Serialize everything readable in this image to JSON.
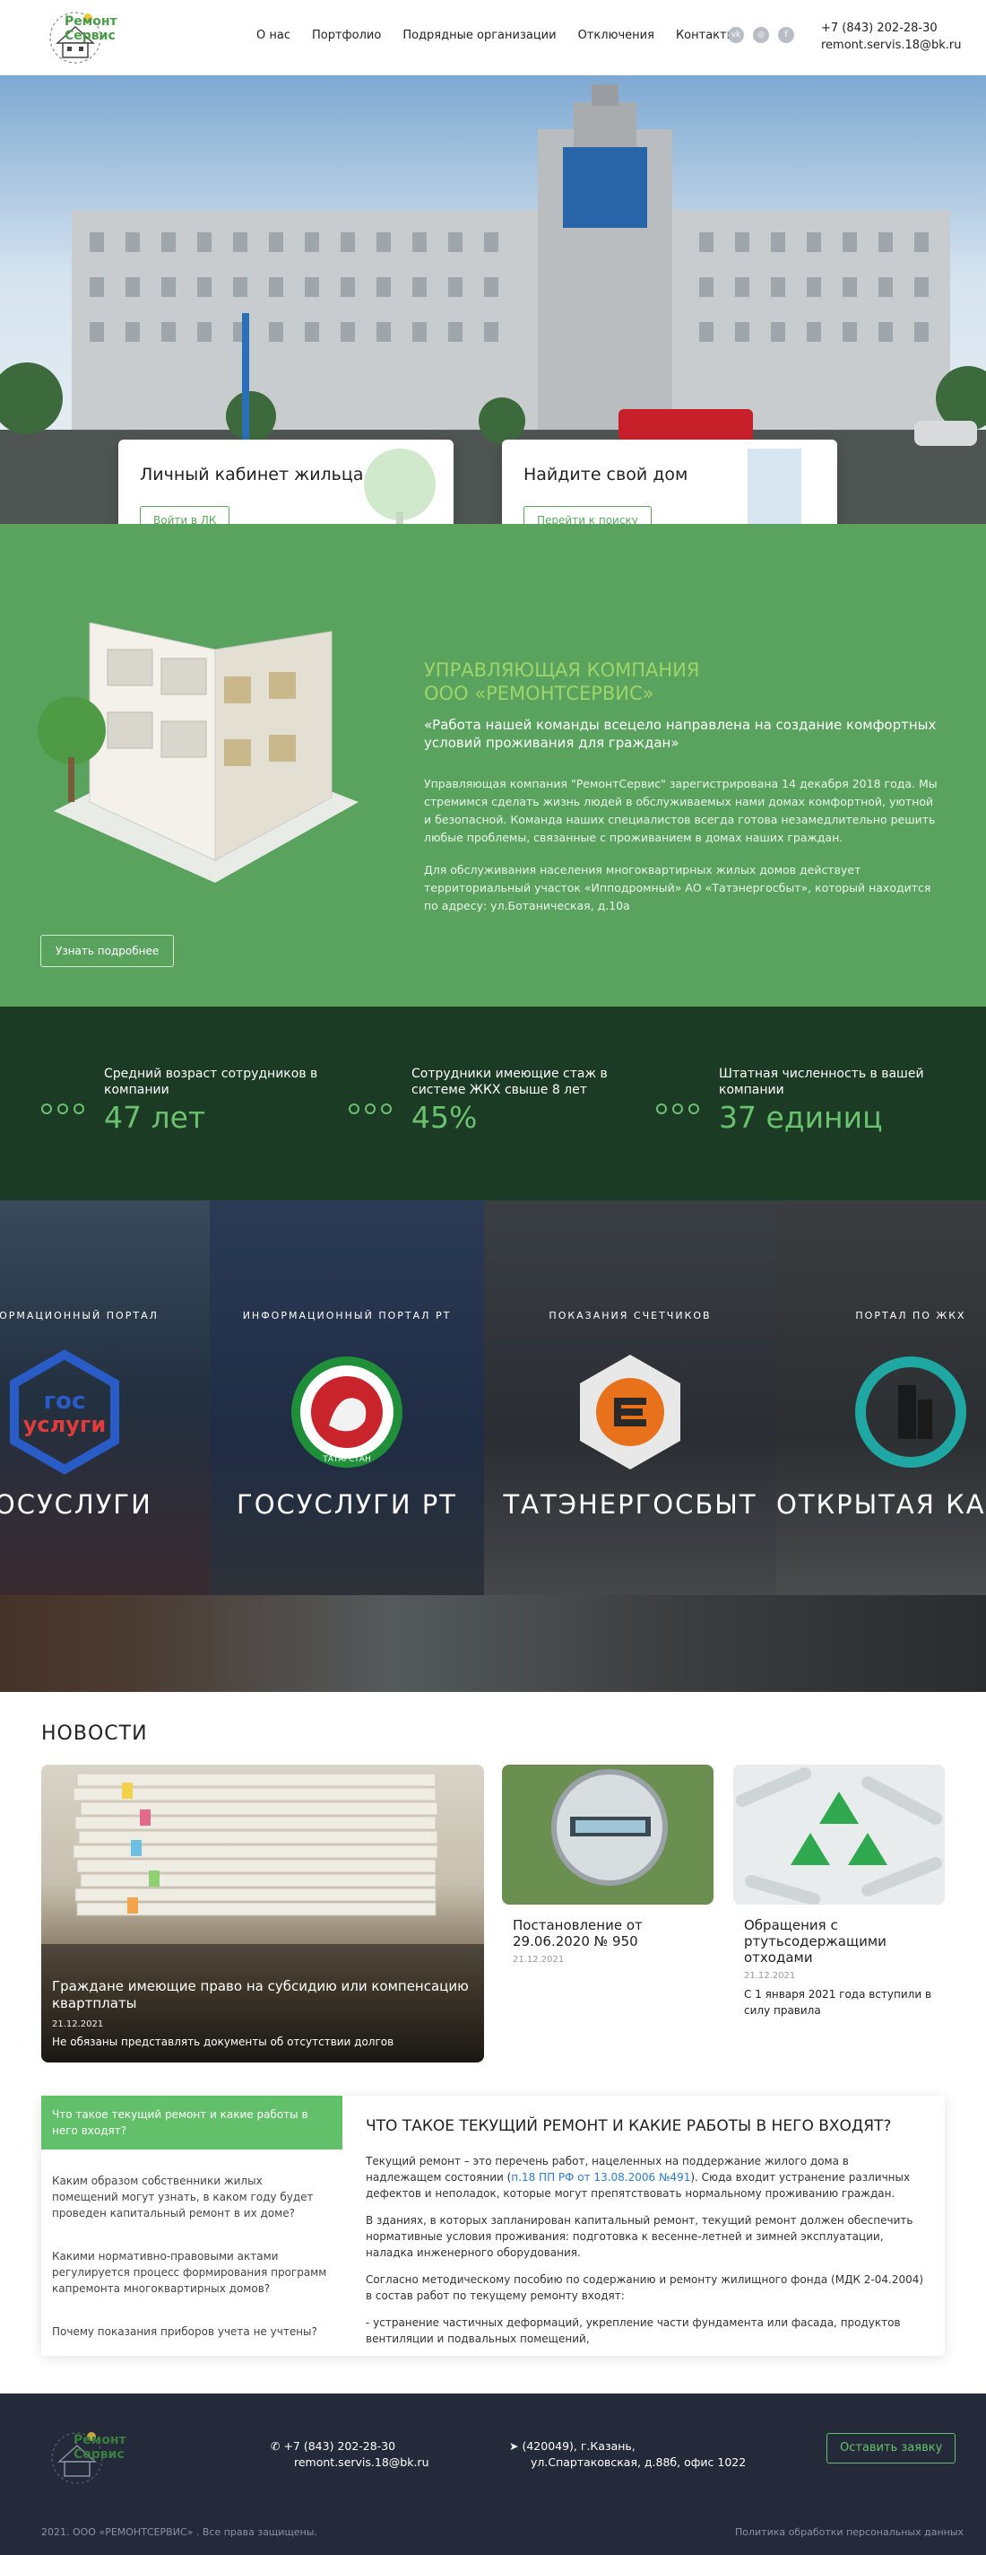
{
  "header": {
    "logo_text_1": "Ремонт",
    "logo_text_2": "Сервис",
    "nav": [
      "О нас",
      "Портфолио",
      "Подрядные организации",
      "Отключения",
      "Контакты"
    ],
    "socials": [
      "vk-icon",
      "instagram-icon",
      "facebook-icon"
    ],
    "phone": "+7 (843) 202-28-30",
    "email": "remont.servis.18@bk.ru"
  },
  "hero": {
    "card1": {
      "title": "Личный кабинет жильца",
      "button": "Войти в ЛК"
    },
    "card2": {
      "title": "Найдите свой дом",
      "button": "Перейти к поиску"
    }
  },
  "about": {
    "title_1": "УПРАВЛЯЮЩАЯ КОМПАНИЯ",
    "title_2": "ООО «РЕМОНТСЕРВИС»",
    "quote": "«Работа нашей команды всецело направлена на создание комфортных условий проживания для граждан»",
    "paragraph_1": "Управляющая компания \"РемонтСервис\" зарегистрирована 14 декабря 2018 года. Мы стремимся сделать жизнь людей в обслуживаемых нами домах комфортной, уютной и безопасной. Команда наших специалистов всегда готова незамедлительно решить любые проблемы, связанные с проживанием в домах наших граждан.",
    "paragraph_2": "Для обслуживания населения многоквартирных жилых домов действует территориальный участок «Ипподромный» АО «Татэнергосбыт», который находится по адресу: ул.Ботаническая, д.10а",
    "button": "Узнать подробнее"
  },
  "stats": [
    {
      "label": "Средний возраст сотрудников в компании",
      "value": "47 лет"
    },
    {
      "label": "Сотрудники имеющие стаж в системе ЖКХ свыше 8 лет",
      "value": "45%"
    },
    {
      "label": "Штатная численность в вашей компании",
      "value": "37 единиц"
    }
  ],
  "portals": [
    {
      "caption": "ИНФОРМАЦИОННЫЙ ПОРТАЛ",
      "name": "ГОСУСЛУГИ",
      "emblem_text_1": "гос",
      "emblem_text_2": "услуги"
    },
    {
      "caption": "ИНФОРМАЦИОННЫЙ ПОРТАЛ РТ",
      "name": "ГОСУСЛУГИ РТ",
      "emblem_text_1": "ТАТАРСТАН"
    },
    {
      "caption": "ПОКАЗАНИЯ СЧЕТЧИКОВ",
      "name": "ТАТЭНЕРГОСБЫТ"
    },
    {
      "caption": "ПОРТАЛ ПО ЖКХ",
      "name": "ОТКРЫТАЯ КАЗАНЬ"
    }
  ],
  "news": {
    "title": "НОВОСТИ",
    "big": {
      "title": "Граждане имеющие право на субсидию или компенсацию квартплаты",
      "date": "21.12.2021",
      "summary": "Не обязаны представлять документы об отсутствии долгов"
    },
    "cards": [
      {
        "title": "Постановление от 29.06.2020 № 950",
        "date": "21.12.2021",
        "summary": ""
      },
      {
        "title": "Обращения с ртутьсодержащими отходами",
        "date": "21.12.2021",
        "summary": "С 1 января 2021 года вступили в силу правила"
      }
    ]
  },
  "faq": {
    "items": [
      "Что такое текущий ремонт и какие работы в него входят?",
      "Каким образом собственники жилых помещений могут узнать, в каком году будет проведен капитальный ремонт в их доме?",
      "Какими нормативно-правовыми актами регулируется процесс формирования программ капремонта многоквартирных домов?",
      "Почему показания приборов учета не учтены?"
    ],
    "heading": "ЧТО ТАКОЕ ТЕКУЩИЙ РЕМОНТ И КАКИЕ РАБОТЫ В НЕГО ВХОДЯТ?",
    "p1_before": "Текущий ремонт – это перечень работ, нацеленных на поддержание жилого дома в надлежащем состоянии (",
    "p1_link": "п.18 ПП РФ от 13.08.2006 №491",
    "p1_after": "). Сюда входит устранение различных дефектов и неполадок, которые могут препятствовать нормальному проживанию граждан.",
    "p2": "В зданиях, в которых запланирован капитальный ремонт, текущий ремонт должен обеспечить нормативные условия проживания: подготовка к весенне-летней и зимней эксплуатации, наладка инженерного оборудования.",
    "p3": "Согласно методическому пособию по содержанию и ремонту жилищного фонда (МДК 2-04.2004) в состав работ по текущему ремонту входят:",
    "p4": "- устранение частичных деформаций, укрепление части фундамента или фасада, продуктов вентиляции и подвальных помещений,"
  },
  "footer": {
    "logo_text_1": "Ремонт",
    "logo_text_2": "Сервис",
    "phone": "+7 (843) 202-28-30",
    "email": "remont.servis.18@bk.ru",
    "address_1": "(420049), г.Казань,",
    "address_2": "ул.Спартаковская, д.88б, офис 1022",
    "button": "Оставить заявку",
    "copyright": "2021. ООО «РЕМОНТСЕРВИС» . Все права защищены.",
    "policy": "Политика обработки персональных данных"
  },
  "colors": {
    "accent": "#5aa35e",
    "stats_bg": "#1b3b25",
    "footer_bg": "#252a3a",
    "link": "#2d7bd1"
  }
}
